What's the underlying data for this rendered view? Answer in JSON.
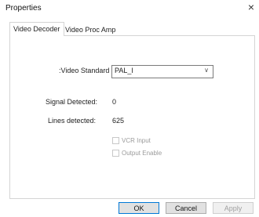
{
  "window": {
    "title": "Properties",
    "close_glyph": "×"
  },
  "tabs": [
    {
      "label": "Video Decoder",
      "active": true
    },
    {
      "label": "Video Proc Amp",
      "active": false
    }
  ],
  "decoder": {
    "video_standard_label": ":Video Standard",
    "video_standard_value": "PAL_I",
    "signal_detected_label": "Signal Detected:",
    "signal_detected_value": "0",
    "lines_detected_label": "Lines detected:",
    "lines_detected_value": "625",
    "vcr_input_label": "VCR Input",
    "vcr_input_checked": false,
    "output_enable_label": "Output Enable",
    "output_enable_checked": false
  },
  "buttons": {
    "ok": "OK",
    "cancel": "Cancel",
    "apply": "Apply"
  },
  "icons": {
    "close": "close-icon",
    "dropdown": "chevron-down-icon"
  }
}
